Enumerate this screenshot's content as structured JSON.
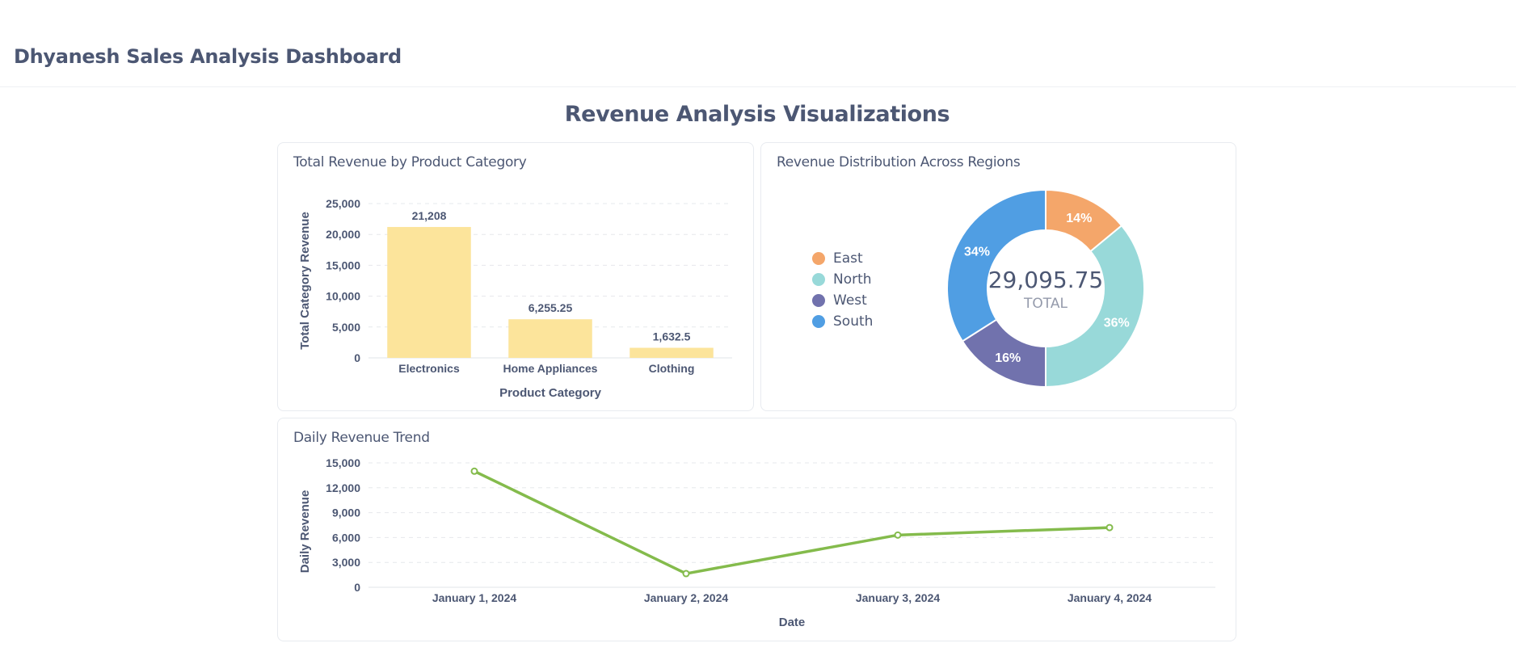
{
  "dashboard": {
    "title": "Dhyanesh Sales Analysis Dashboard"
  },
  "section": {
    "title": "Revenue Analysis Visualizations"
  },
  "colors": {
    "text": "#4c5773",
    "bar": "#fce49b",
    "line": "#84bb4c",
    "east": "#f4a66a",
    "north": "#98d9d9",
    "west": "#7172ad",
    "south": "#509ee3"
  },
  "chart_data": [
    {
      "id": "bar",
      "type": "bar",
      "title": "Total Revenue by Product Category",
      "categories": [
        "Electronics",
        "Home Appliances",
        "Clothing"
      ],
      "values": [
        21208,
        6255.25,
        1632.5
      ],
      "data_labels": [
        "21,208",
        "6,255.25",
        "1,632.5"
      ],
      "xlabel": "Product Category",
      "ylabel": "Total Category Revenue",
      "ylim": [
        0,
        25000
      ],
      "yticks": [
        0,
        5000,
        10000,
        15000,
        20000,
        25000
      ],
      "ytick_labels": [
        "0",
        "5,000",
        "10,000",
        "15,000",
        "20,000",
        "25,000"
      ],
      "grid": true
    },
    {
      "id": "donut",
      "type": "pie",
      "title": "Revenue Distribution Across Regions",
      "slices": [
        {
          "name": "East",
          "share": 14,
          "label": "14%"
        },
        {
          "name": "North",
          "share": 36,
          "label": "36%"
        },
        {
          "name": "West",
          "share": 16,
          "label": "16%"
        },
        {
          "name": "South",
          "share": 34,
          "label": "34%"
        }
      ],
      "total_value": "29,095.75",
      "total_label": "TOTAL",
      "legend_position": "left"
    },
    {
      "id": "line",
      "type": "line",
      "title": "Daily Revenue Trend",
      "x": [
        "January 1, 2024",
        "January 2, 2024",
        "January 3, 2024",
        "January 4, 2024"
      ],
      "values": [
        14000,
        1650,
        6300,
        7200
      ],
      "xlabel": "Date",
      "ylabel": "Daily Revenue",
      "ylim": [
        0,
        15000
      ],
      "yticks": [
        0,
        3000,
        6000,
        9000,
        12000,
        15000
      ],
      "ytick_labels": [
        "0",
        "3,000",
        "6,000",
        "9,000",
        "12,000",
        "15,000"
      ],
      "grid": true
    }
  ]
}
